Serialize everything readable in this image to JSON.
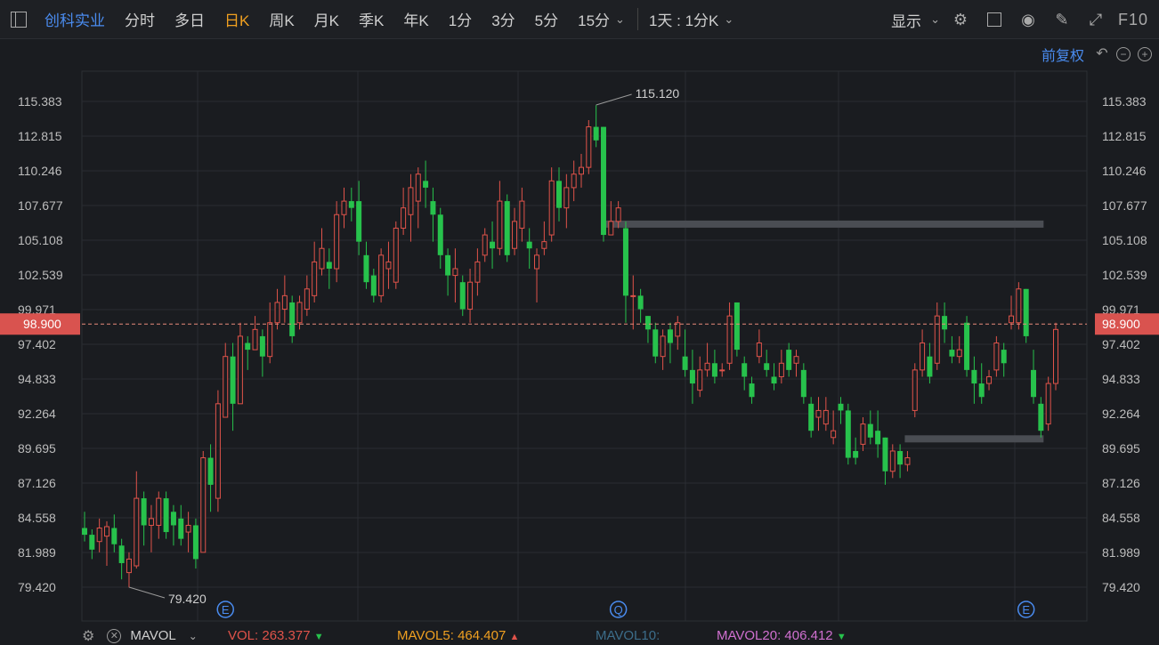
{
  "toolbar": {
    "title": "创科实业",
    "tabs": [
      "分时",
      "多日",
      "日K",
      "周K",
      "月K",
      "季K",
      "年K",
      "1分",
      "3分",
      "5分",
      "15分"
    ],
    "active_tab": "日K",
    "range": "1天 : 1分K",
    "show": "显示",
    "f10": "F10"
  },
  "adjust": "前复权",
  "price_tag": "98.900",
  "high_label": "115.120",
  "low_label": "79.420",
  "markers": [
    "E",
    "Q",
    "E"
  ],
  "bottom": {
    "mavol": "MAVOL",
    "vol": "VOL: 263.377",
    "mavol5": "MAVOL5: 464.407",
    "mavol10": "MAVOL10:",
    "mavol20": "MAVOL20: 406.412"
  },
  "colors": {
    "up": "#e0534a",
    "down": "#27c24c",
    "accent": "#4a8cf0",
    "active": "#f0a020",
    "price_line": "#e88a7a"
  },
  "chart_data": {
    "type": "candlestick",
    "y_ticks": [
      "115.383",
      "112.815",
      "110.246",
      "107.677",
      "105.108",
      "102.539",
      "99.971",
      "97.402",
      "94.833",
      "92.264",
      "89.695",
      "87.126",
      "84.558",
      "81.989",
      "79.420"
    ],
    "ylim": [
      78.5,
      117.0
    ],
    "current_price": 98.9,
    "high": 115.12,
    "low": 79.42,
    "hlines": [
      {
        "value": 106.3,
        "from_index": 70,
        "to_index": 129
      },
      {
        "value": 90.4,
        "from_index": 111,
        "to_index": 129
      }
    ],
    "marker_indices": [
      19,
      72,
      127
    ],
    "candles": [
      [
        83.8,
        83.3,
        85.0,
        82.8
      ],
      [
        83.3,
        82.2,
        83.7,
        81.5
      ],
      [
        82.8,
        83.8,
        84.5,
        82.0
      ],
      [
        83.2,
        83.9,
        84.3,
        81.0
      ],
      [
        83.8,
        82.6,
        84.8,
        82.0
      ],
      [
        82.5,
        81.2,
        83.0,
        80.0
      ],
      [
        80.5,
        81.5,
        82.0,
        79.4
      ],
      [
        81.0,
        86.0,
        88.0,
        80.8
      ],
      [
        86.0,
        84.0,
        86.5,
        82.5
      ],
      [
        84.0,
        84.5,
        85.5,
        82.0
      ],
      [
        84.0,
        86.0,
        86.5,
        83.0
      ],
      [
        86.0,
        83.5,
        86.5,
        83.0
      ],
      [
        85.0,
        84.0,
        85.5,
        82.5
      ],
      [
        84.5,
        83.0,
        85.5,
        82.5
      ],
      [
        83.5,
        84.0,
        85.0,
        82.0
      ],
      [
        84.0,
        81.5,
        84.5,
        80.8
      ],
      [
        82.0,
        89.0,
        89.5,
        82.0
      ],
      [
        89.0,
        87.0,
        90.0,
        85.0
      ],
      [
        86.0,
        93.0,
        94.0,
        85.0
      ],
      [
        92.0,
        96.5,
        97.5,
        92.0
      ],
      [
        96.5,
        93.0,
        97.5,
        91.0
      ],
      [
        93.0,
        98.0,
        99.0,
        93.0
      ],
      [
        97.5,
        97.0,
        98.0,
        95.5
      ],
      [
        97.0,
        98.5,
        99.5,
        97.0
      ],
      [
        98.0,
        96.5,
        98.5,
        95.0
      ],
      [
        96.5,
        99.0,
        100.5,
        96.0
      ],
      [
        99.0,
        100.5,
        101.5,
        98.5
      ],
      [
        100.0,
        101.0,
        102.5,
        99.0
      ],
      [
        100.5,
        98.0,
        101.0,
        97.5
      ],
      [
        99.0,
        100.5,
        101.0,
        98.5
      ],
      [
        100.0,
        101.5,
        102.5,
        99.5
      ],
      [
        101.0,
        103.5,
        105.0,
        100.5
      ],
      [
        103.0,
        104.5,
        106.0,
        102.5
      ],
      [
        103.5,
        103.0,
        104.5,
        101.5
      ],
      [
        103.0,
        107.0,
        108.0,
        102.0
      ],
      [
        107.0,
        108.0,
        109.0,
        106.0
      ],
      [
        108.0,
        107.5,
        109.0,
        106.5
      ],
      [
        108.0,
        105.0,
        109.5,
        104.0
      ],
      [
        104.0,
        102.0,
        105.0,
        101.5
      ],
      [
        102.5,
        101.0,
        103.0,
        100.5
      ],
      [
        101.0,
        104.0,
        104.5,
        100.5
      ],
      [
        103.0,
        103.5,
        105.0,
        101.5
      ],
      [
        102.0,
        106.0,
        106.5,
        101.5
      ],
      [
        106.0,
        107.5,
        109.0,
        105.5
      ],
      [
        107.0,
        109.0,
        110.0,
        105.0
      ],
      [
        108.0,
        110.0,
        110.5,
        106.0
      ],
      [
        109.5,
        109.0,
        111.0,
        107.5
      ],
      [
        108.0,
        107.0,
        109.0,
        105.0
      ],
      [
        107.0,
        104.0,
        107.5,
        103.0
      ],
      [
        104.0,
        102.5,
        104.5,
        101.0
      ],
      [
        102.5,
        103.0,
        104.5,
        100.5
      ],
      [
        102.0,
        100.0,
        102.5,
        99.5
      ],
      [
        100.0,
        102.0,
        103.0,
        99.0
      ],
      [
        102.0,
        103.5,
        104.5,
        101.0
      ],
      [
        104.0,
        105.5,
        106.0,
        103.5
      ],
      [
        105.0,
        104.5,
        106.5,
        103.0
      ],
      [
        104.5,
        108.0,
        109.5,
        104.0
      ],
      [
        108.0,
        104.0,
        108.5,
        103.5
      ],
      [
        104.5,
        106.5,
        107.5,
        104.0
      ],
      [
        106.0,
        108.0,
        109.0,
        105.0
      ],
      [
        105.0,
        104.5,
        106.0,
        103.0
      ],
      [
        103.0,
        104.0,
        104.5,
        100.5
      ],
      [
        104.5,
        105.0,
        106.5,
        104.0
      ],
      [
        105.5,
        109.5,
        110.5,
        105.0
      ],
      [
        109.5,
        107.5,
        110.5,
        106.5
      ],
      [
        107.5,
        109.0,
        110.0,
        106.0
      ],
      [
        109.0,
        110.0,
        111.0,
        108.0
      ],
      [
        110.0,
        110.5,
        111.5,
        109.0
      ],
      [
        110.5,
        113.5,
        114.0,
        110.0
      ],
      [
        113.5,
        112.5,
        115.1,
        112.0
      ],
      [
        113.5,
        105.5,
        113.5,
        105.0
      ],
      [
        105.5,
        106.5,
        108.0,
        105.5
      ],
      [
        106.5,
        107.5,
        108.0,
        106.0
      ],
      [
        106.0,
        101.0,
        106.5,
        99.0
      ],
      [
        101.0,
        101.0,
        102.5,
        98.5
      ],
      [
        101.0,
        100.0,
        101.5,
        99.0
      ],
      [
        99.5,
        98.5,
        99.5,
        97.5
      ],
      [
        98.5,
        96.5,
        99.0,
        96.0
      ],
      [
        96.5,
        98.0,
        98.5,
        95.5
      ],
      [
        98.5,
        97.5,
        99.0,
        96.0
      ],
      [
        98.0,
        99.0,
        99.5,
        97.0
      ],
      [
        96.5,
        95.5,
        98.5,
        95.0
      ],
      [
        95.5,
        94.5,
        97.0,
        93.0
      ],
      [
        94.0,
        95.5,
        96.5,
        93.5
      ],
      [
        95.5,
        96.0,
        97.5,
        95.0
      ],
      [
        96.0,
        95.0,
        97.0,
        94.5
      ],
      [
        95.5,
        95.5,
        96.0,
        95.0
      ],
      [
        96.0,
        99.5,
        100.5,
        95.5
      ],
      [
        100.5,
        97.0,
        100.5,
        96.5
      ],
      [
        96.0,
        95.0,
        96.5,
        94.0
      ],
      [
        94.5,
        93.5,
        95.0,
        93.0
      ],
      [
        96.5,
        97.5,
        98.5,
        96.0
      ],
      [
        96.0,
        95.5,
        97.0,
        95.0
      ],
      [
        95.0,
        94.5,
        96.0,
        94.0
      ],
      [
        95.0,
        96.0,
        97.0,
        94.5
      ],
      [
        97.0,
        95.5,
        97.5,
        95.0
      ],
      [
        96.0,
        96.5,
        97.0,
        95.0
      ],
      [
        95.5,
        93.5,
        96.0,
        93.0
      ],
      [
        93.0,
        91.0,
        93.5,
        90.5
      ],
      [
        92.0,
        92.5,
        93.5,
        91.0
      ],
      [
        91.5,
        92.5,
        93.5,
        91.0
      ],
      [
        90.5,
        91.0,
        92.5,
        90.0
      ],
      [
        93.0,
        92.5,
        93.5,
        91.5
      ],
      [
        92.5,
        89.0,
        93.0,
        88.5
      ],
      [
        89.5,
        89.0,
        90.5,
        88.5
      ],
      [
        90.0,
        91.5,
        92.0,
        89.5
      ],
      [
        91.5,
        90.5,
        92.5,
        90.0
      ],
      [
        91.0,
        90.0,
        92.5,
        89.0
      ],
      [
        90.5,
        88.0,
        90.5,
        87.0
      ],
      [
        88.0,
        89.5,
        90.0,
        87.5
      ],
      [
        89.5,
        88.5,
        90.0,
        87.5
      ],
      [
        88.5,
        89.0,
        89.5,
        88.0
      ],
      [
        92.5,
        95.5,
        96.0,
        92.0
      ],
      [
        95.5,
        97.5,
        98.5,
        95.0
      ],
      [
        96.5,
        95.0,
        97.5,
        94.5
      ],
      [
        96.0,
        99.5,
        100.5,
        95.5
      ],
      [
        99.5,
        98.5,
        100.5,
        97.5
      ],
      [
        97.0,
        96.5,
        98.0,
        96.0
      ],
      [
        96.5,
        97.0,
        98.0,
        96.0
      ],
      [
        99.0,
        95.5,
        99.5,
        95.0
      ],
      [
        95.5,
        94.5,
        96.5,
        93.0
      ],
      [
        94.5,
        93.5,
        96.0,
        93.0
      ],
      [
        94.5,
        95.0,
        95.5,
        94.0
      ],
      [
        95.5,
        97.5,
        98.0,
        95.0
      ],
      [
        97.0,
        96.0,
        97.5,
        95.0
      ],
      [
        99.0,
        99.5,
        101.0,
        98.5
      ],
      [
        99.0,
        101.5,
        102.0,
        98.5
      ],
      [
        101.5,
        98.0,
        101.5,
        97.5
      ],
      [
        95.5,
        93.5,
        97.0,
        93.0
      ],
      [
        93.0,
        91.0,
        93.5,
        90.5
      ],
      [
        91.5,
        94.5,
        95.0,
        91.0
      ],
      [
        94.5,
        98.5,
        99.0,
        94.0
      ]
    ]
  }
}
